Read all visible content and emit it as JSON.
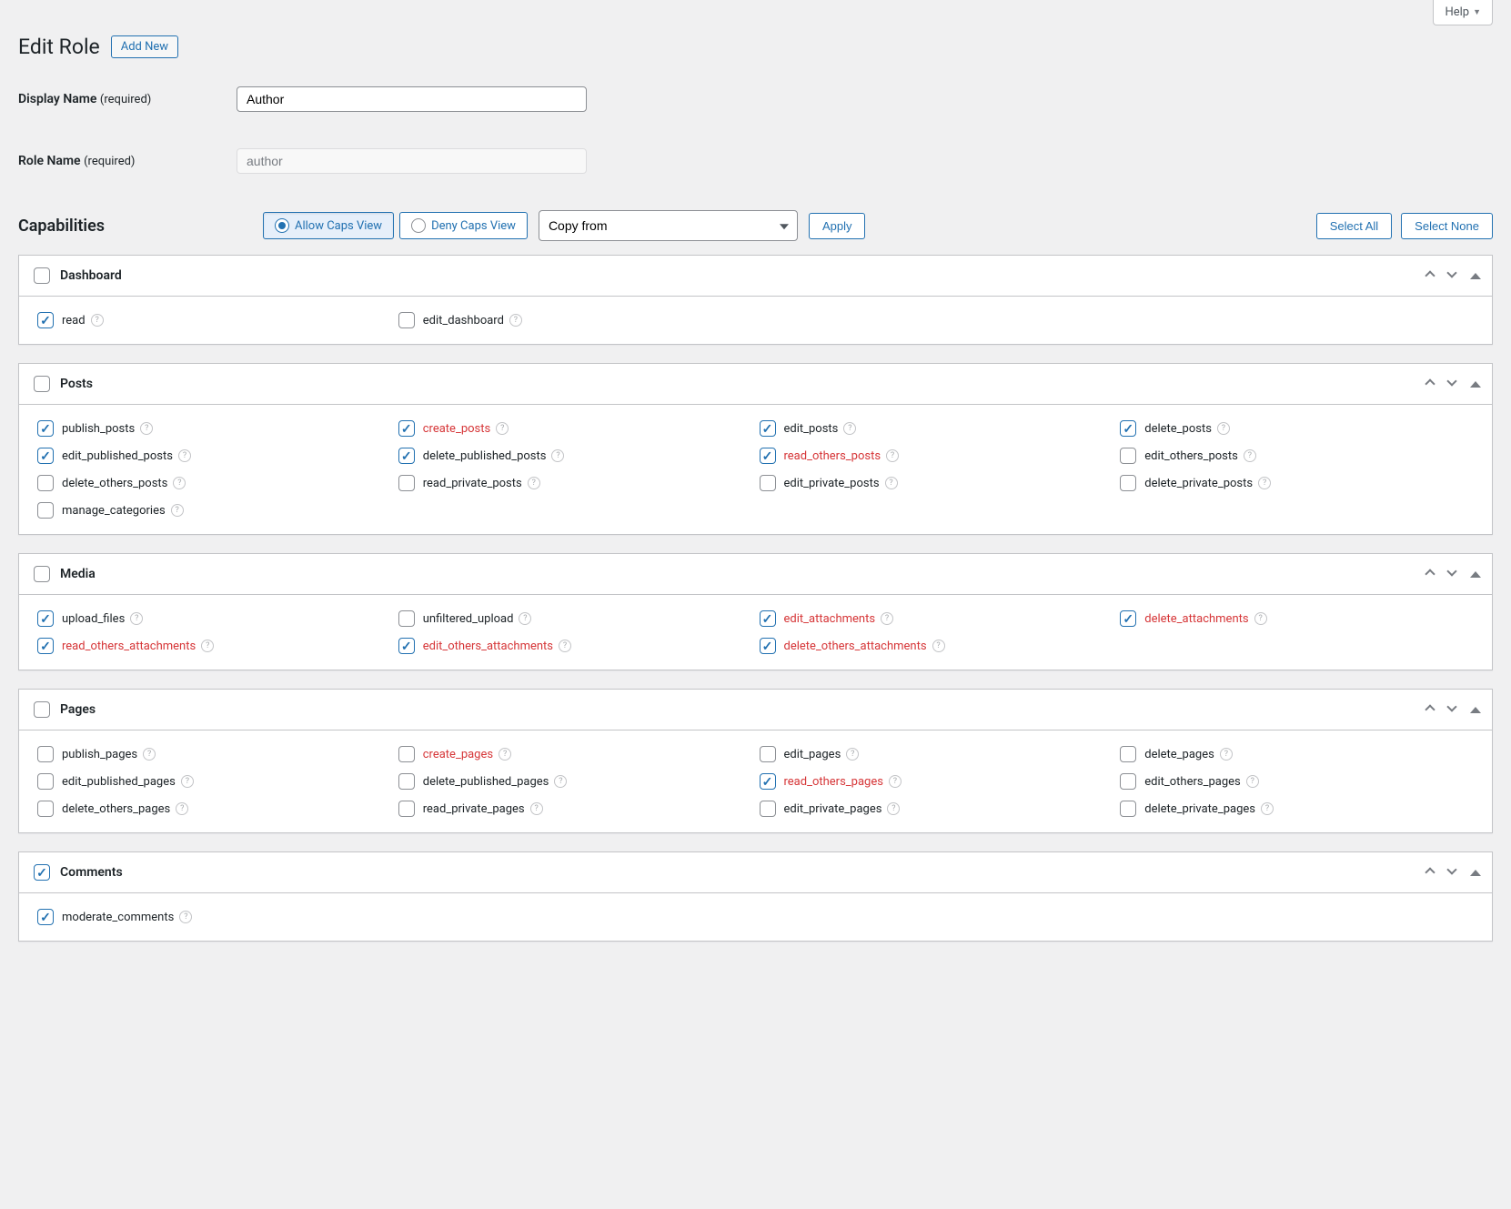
{
  "help_label": "Help",
  "page_title": "Edit Role",
  "add_new_label": "Add New",
  "display_name": {
    "label": "Display Name",
    "required": "(required)",
    "value": "Author"
  },
  "role_name": {
    "label": "Role Name",
    "required": "(required)",
    "value": "author"
  },
  "capabilities_heading": "Capabilities",
  "view_toggle": {
    "allow": "Allow Caps View",
    "deny": "Deny Caps View"
  },
  "copy_from_label": "Copy from",
  "apply_label": "Apply",
  "select_all_label": "Select All",
  "select_none_label": "Select None",
  "groups": [
    {
      "id": "dashboard",
      "title": "Dashboard",
      "group_checked": false,
      "caps": [
        {
          "label": "read",
          "checked": true,
          "removed": false,
          "help": true
        },
        {
          "label": "edit_dashboard",
          "checked": false,
          "removed": false,
          "help": true
        }
      ]
    },
    {
      "id": "posts",
      "title": "Posts",
      "group_checked": false,
      "caps": [
        {
          "label": "publish_posts",
          "checked": true,
          "removed": false,
          "help": true
        },
        {
          "label": "create_posts",
          "checked": true,
          "removed": true,
          "help": true
        },
        {
          "label": "edit_posts",
          "checked": true,
          "removed": false,
          "help": true
        },
        {
          "label": "delete_posts",
          "checked": true,
          "removed": false,
          "help": true
        },
        {
          "label": "edit_published_posts",
          "checked": true,
          "removed": false,
          "help": true
        },
        {
          "label": "delete_published_posts",
          "checked": true,
          "removed": false,
          "help": true
        },
        {
          "label": "read_others_posts",
          "checked": true,
          "removed": true,
          "help": true
        },
        {
          "label": "edit_others_posts",
          "checked": false,
          "removed": false,
          "help": true
        },
        {
          "label": "delete_others_posts",
          "checked": false,
          "removed": false,
          "help": true
        },
        {
          "label": "read_private_posts",
          "checked": false,
          "removed": false,
          "help": true
        },
        {
          "label": "edit_private_posts",
          "checked": false,
          "removed": false,
          "help": true
        },
        {
          "label": "delete_private_posts",
          "checked": false,
          "removed": false,
          "help": true
        },
        {
          "label": "manage_categories",
          "checked": false,
          "removed": false,
          "help": true
        }
      ]
    },
    {
      "id": "media",
      "title": "Media",
      "group_checked": false,
      "caps": [
        {
          "label": "upload_files",
          "checked": true,
          "removed": false,
          "help": true
        },
        {
          "label": "unfiltered_upload",
          "checked": false,
          "removed": false,
          "help": true
        },
        {
          "label": "edit_attachments",
          "checked": true,
          "removed": true,
          "help": true
        },
        {
          "label": "delete_attachments",
          "checked": true,
          "removed": true,
          "help": true
        },
        {
          "label": "read_others_attachments",
          "checked": true,
          "removed": true,
          "help": true
        },
        {
          "label": "edit_others_attachments",
          "checked": true,
          "removed": true,
          "help": true
        },
        {
          "label": "delete_others_attachments",
          "checked": true,
          "removed": true,
          "help": true
        }
      ]
    },
    {
      "id": "pages",
      "title": "Pages",
      "group_checked": false,
      "caps": [
        {
          "label": "publish_pages",
          "checked": false,
          "removed": false,
          "help": true
        },
        {
          "label": "create_pages",
          "checked": false,
          "removed": true,
          "help": true
        },
        {
          "label": "edit_pages",
          "checked": false,
          "removed": false,
          "help": true
        },
        {
          "label": "delete_pages",
          "checked": false,
          "removed": false,
          "help": true
        },
        {
          "label": "edit_published_pages",
          "checked": false,
          "removed": false,
          "help": true
        },
        {
          "label": "delete_published_pages",
          "checked": false,
          "removed": false,
          "help": true
        },
        {
          "label": "read_others_pages",
          "checked": true,
          "removed": true,
          "help": true
        },
        {
          "label": "edit_others_pages",
          "checked": false,
          "removed": false,
          "help": true
        },
        {
          "label": "delete_others_pages",
          "checked": false,
          "removed": false,
          "help": true
        },
        {
          "label": "read_private_pages",
          "checked": false,
          "removed": false,
          "help": true
        },
        {
          "label": "edit_private_pages",
          "checked": false,
          "removed": false,
          "help": true
        },
        {
          "label": "delete_private_pages",
          "checked": false,
          "removed": false,
          "help": true
        }
      ]
    },
    {
      "id": "comments",
      "title": "Comments",
      "group_checked": true,
      "caps": [
        {
          "label": "moderate_comments",
          "checked": true,
          "removed": false,
          "help": true
        }
      ]
    }
  ]
}
